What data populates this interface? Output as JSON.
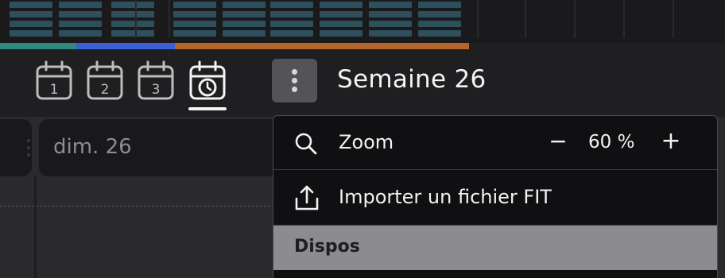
{
  "toolbar": {
    "views": [
      {
        "name": "day-view",
        "icon": "calendar-1-icon",
        "number": "1",
        "active": false
      },
      {
        "name": "two-day-view",
        "icon": "calendar-2-icon",
        "number": "2",
        "active": false
      },
      {
        "name": "three-day-view",
        "icon": "calendar-3-icon",
        "number": "3",
        "active": false
      },
      {
        "name": "week-view",
        "icon": "calendar-clock-icon",
        "active": true
      }
    ],
    "more_icon": "kebab-menu-icon",
    "week_title": "Semaine 26"
  },
  "agenda": {
    "day_label": "dim. 26"
  },
  "menu": {
    "zoom": {
      "icon": "search-icon",
      "label": "Zoom",
      "value": "60 %",
      "decrease": "−",
      "increase": "+"
    },
    "import": {
      "icon": "upload-icon",
      "label": "Importer un fichier FIT"
    },
    "section": {
      "label": "Dispos"
    }
  },
  "colors": {
    "progress_segments": [
      "#2f8a7e",
      "#3b5fd4",
      "#b5642a"
    ],
    "menu_bg": "#101012",
    "section_bg": "#8c8c90"
  }
}
